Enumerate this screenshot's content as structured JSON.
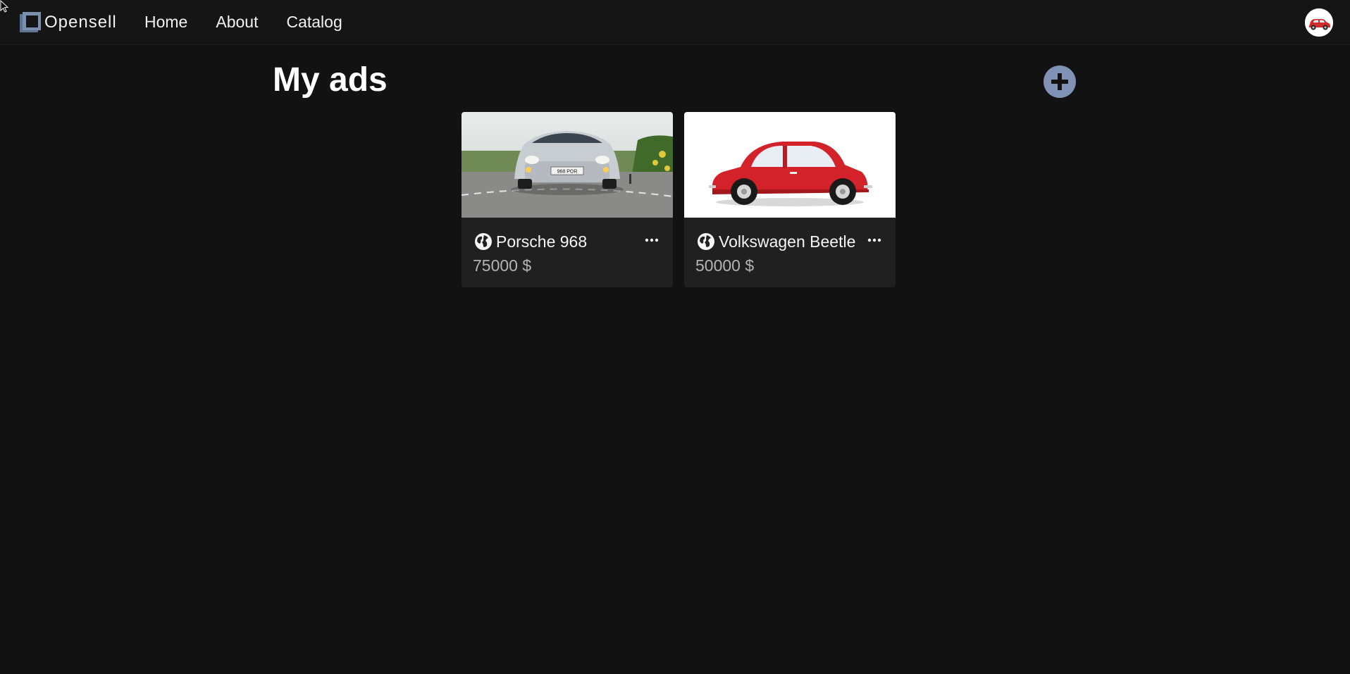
{
  "navbar": {
    "brand": "Opensell",
    "links": [
      "Home",
      "About",
      "Catalog"
    ],
    "avatar_icon": "red-car-avatar-icon"
  },
  "main": {
    "title": "My ads",
    "add_icon": "plus-icon"
  },
  "ads": [
    {
      "title": "Porsche 968",
      "price": "75000 $",
      "visibility_icon": "globe-icon",
      "image": "silver-porsche-photo"
    },
    {
      "title": "Volkswagen Beetle",
      "price": "50000 $",
      "visibility_icon": "globe-icon",
      "image": "red-beetle-photo"
    }
  ],
  "colors": {
    "background": "#121212",
    "navbar": "#151515",
    "card": "#202020",
    "accent": "#7f92b5",
    "price_text": "#b4b4b4"
  }
}
